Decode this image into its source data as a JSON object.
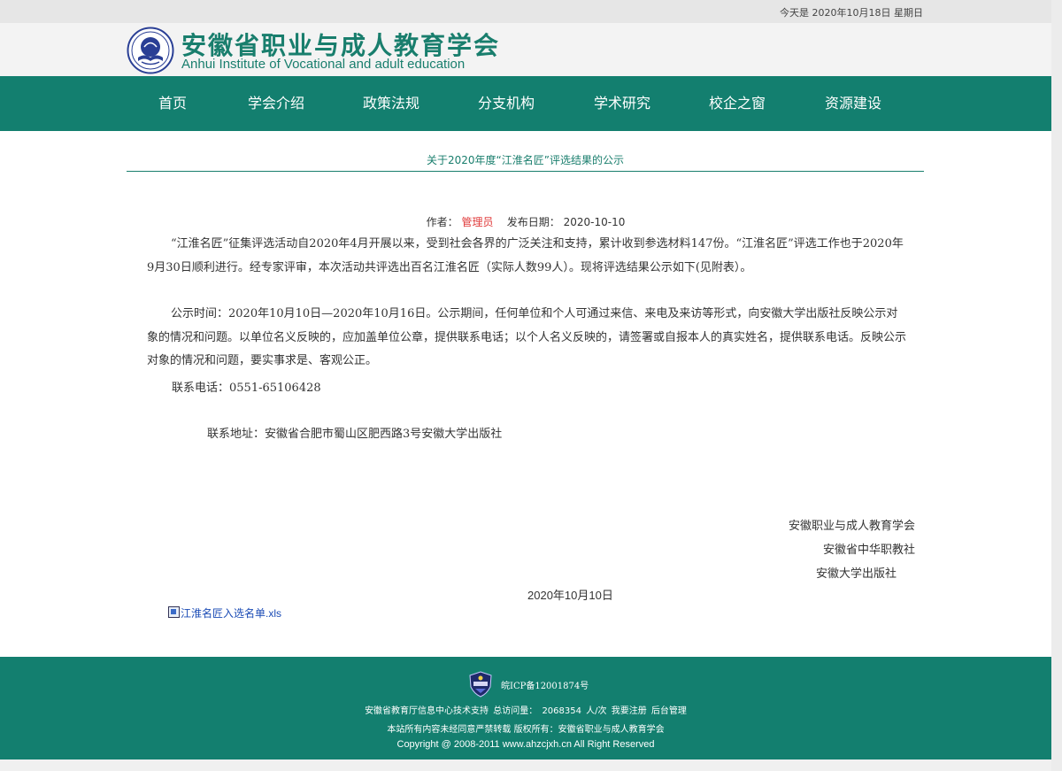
{
  "topbar": {
    "date_text": "今天是 2020年10月18日 星期日"
  },
  "header": {
    "title": "安徽省职业与成人教育学会",
    "subtitle": "Anhui Institute of Vocational and adult education"
  },
  "nav": {
    "items": [
      "首页",
      "学会介绍",
      "政策法规",
      "分支机构",
      "学术研究",
      "校企之窗",
      "资源建设"
    ]
  },
  "article": {
    "title": "关于2020年度“江淮名匠”评选结果的公示",
    "author_label": "作者：",
    "author": "管理员",
    "date_label": "发布日期：",
    "date": "2020-10-10",
    "paragraph1": "“江淮名匠”征集评选活动自2020年4月开展以来，受到社会各界的广泛关注和支持，累计收到参选材料147份。“江淮名匠”评选工作也于2020年9月30日顺利进行。经专家评审，本次活动共评选出百名江淮名匠（实际人数99人）。现将评选结果公示如下(见附表）。",
    "paragraph2": "公示时间：2020年10月10日—2020年10月16日。公示期间，任何单位和个人可通过来信、来电及来访等形式，向安徽大学出版社反映公示对象的情况和问题。以单位名义反映的，应加盖单位公章，提供联系电话；以个人名义反映的，请签署或自报本人的真实姓名，提供联系电话。反映公示对象的情况和问题，要实事求是、客观公正。",
    "phone": "联系电话：0551-65106428",
    "address": "联系地址：安徽省合肥市蜀山区肥西路3号安徽大学出版社",
    "signatures": [
      "安徽职业与成人教育学会",
      "安徽省中华职教社",
      "安徽大学出版社"
    ],
    "sign_date": "2020年10月10日",
    "attachment": "江淮名匠入选名单.xls"
  },
  "footer": {
    "icp": "皖ICP备12001874号",
    "tech_support": "安徽省教育厅信息中心技术支持",
    "visits_label": "总访问量：",
    "visits_count": "2068354",
    "visits_unit": "人/次",
    "register_link": "我要注册",
    "admin_link": "后台管理",
    "rights": "本站所有内容未经同意严禁转载 版权所有：安徽省职业与成人教育学会",
    "copyright": "Copyright @ 2008-2011 www.ahzcjxh.cn All Right Reserved"
  },
  "colors": {
    "brand_green": "#137f6f",
    "title_green": "#197e6d",
    "author_red": "#e03b3b",
    "link_blue": "#1a4bb5"
  }
}
